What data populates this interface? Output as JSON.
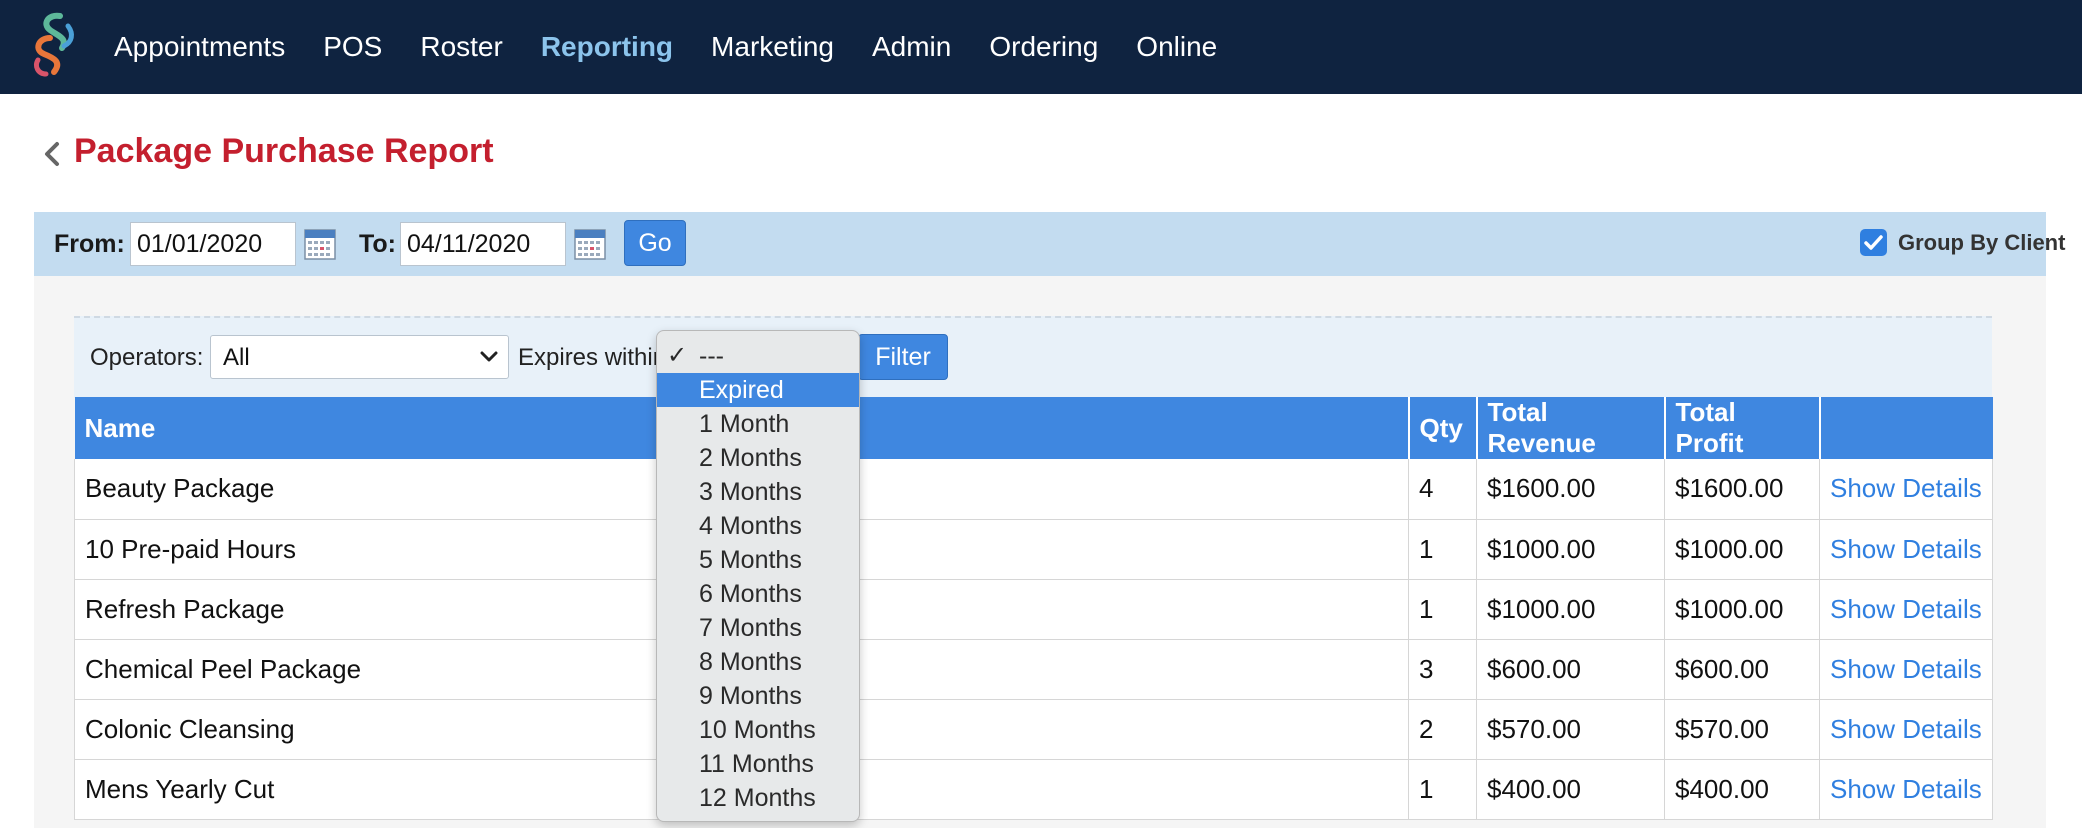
{
  "nav": {
    "items": [
      {
        "label": "Appointments",
        "active": false
      },
      {
        "label": "POS",
        "active": false
      },
      {
        "label": "Roster",
        "active": false
      },
      {
        "label": "Reporting",
        "active": true
      },
      {
        "label": "Marketing",
        "active": false
      },
      {
        "label": "Admin",
        "active": false
      },
      {
        "label": "Ordering",
        "active": false
      },
      {
        "label": "Online",
        "active": false
      }
    ]
  },
  "page": {
    "title": "Package Purchase Report"
  },
  "date_filter": {
    "from_label": "From:",
    "from_value": "01/01/2020",
    "to_label": "To:",
    "to_value": "04/11/2020",
    "go_label": "Go",
    "group_by_client_label": "Group By Client",
    "group_by_client_checked": true
  },
  "filters": {
    "operators_label": "Operators:",
    "operators_value": "All",
    "expires_label": "Expires within",
    "filter_label": "Filter"
  },
  "expires_dropdown": {
    "checked_option": "---",
    "highlighted_option": "Expired",
    "options": [
      "---",
      "Expired",
      "1 Month",
      "2 Months",
      "3 Months",
      "4 Months",
      "5 Months",
      "6 Months",
      "7 Months",
      "8 Months",
      "9 Months",
      "10 Months",
      "11 Months",
      "12 Months"
    ]
  },
  "table": {
    "headers": {
      "name": "Name",
      "qty": "Qty",
      "revenue": "Total Revenue",
      "profit": "Total Profit",
      "action": ""
    },
    "rows": [
      {
        "name": "Beauty Package",
        "qty": "4",
        "revenue": "$1600.00",
        "profit": "$1600.00",
        "action": "Show Details"
      },
      {
        "name": "10 Pre-paid Hours",
        "qty": "1",
        "revenue": "$1000.00",
        "profit": "$1000.00",
        "action": "Show Details"
      },
      {
        "name": "Refresh Package",
        "qty": "1",
        "revenue": "$1000.00",
        "profit": "$1000.00",
        "action": "Show Details"
      },
      {
        "name": "Chemical Peel Package",
        "qty": "3",
        "revenue": "$600.00",
        "profit": "$600.00",
        "action": "Show Details"
      },
      {
        "name": "Colonic Cleansing",
        "qty": "2",
        "revenue": "$570.00",
        "profit": "$570.00",
        "action": "Show Details"
      },
      {
        "name": "Mens Yearly Cut",
        "qty": "1",
        "revenue": "$400.00",
        "profit": "$400.00",
        "action": "Show Details"
      }
    ]
  },
  "colors": {
    "nav_bg": "#0f2340",
    "nav_active": "#8cc4ec",
    "title_red": "#c41f2e",
    "accent_blue": "#3f87e0",
    "date_bar_bg": "#c3dcf0"
  },
  "icons": [
    "app-logo-icon",
    "chevron-left-icon",
    "calendar-icon",
    "chevron-down-icon",
    "checkmark-icon"
  ]
}
